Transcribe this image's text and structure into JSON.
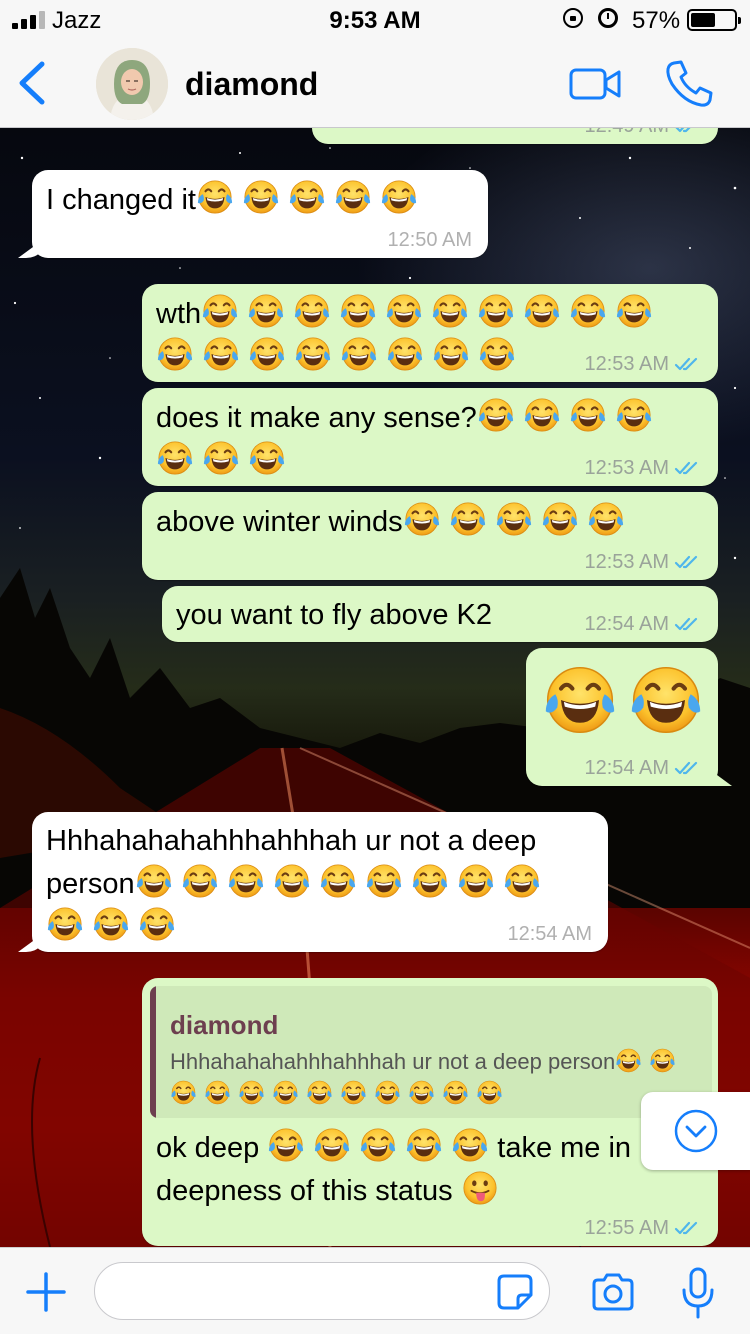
{
  "status_bar": {
    "carrier": "Jazz",
    "time": "9:53 AM",
    "battery_percent": "57%",
    "battery_level": 0.57,
    "signal_bars_active": 3,
    "signal_bars_total": 4
  },
  "header": {
    "back_icon": "chevron-left-icon",
    "contact_name": "diamond",
    "video_call_icon": "video-camera-icon",
    "voice_call_icon": "phone-icon",
    "accent_color": "#157efb"
  },
  "messages": [
    {
      "id": "m0",
      "direction": "outgoing",
      "text": "",
      "time": "12:49 AM",
      "status": "read",
      "partially_visible": true
    },
    {
      "id": "m1",
      "direction": "incoming",
      "text": "I changed it",
      "emoji_count": 5,
      "time": "12:50 AM"
    },
    {
      "id": "m2",
      "direction": "outgoing",
      "text": "wth",
      "emoji_count": 18,
      "time": "12:53 AM",
      "status": "read"
    },
    {
      "id": "m3",
      "direction": "outgoing",
      "text": "does it make any sense?",
      "emoji_count": 7,
      "time": "12:53 AM",
      "status": "read"
    },
    {
      "id": "m4",
      "direction": "outgoing",
      "text": "above winter winds",
      "emoji_count": 5,
      "time": "12:53 AM",
      "status": "read"
    },
    {
      "id": "m5",
      "direction": "outgoing",
      "text": "you want to fly above K2",
      "time": "12:54 AM",
      "status": "read"
    },
    {
      "id": "m6",
      "direction": "outgoing",
      "text": "",
      "emoji_count": 2,
      "time": "12:54 AM",
      "status": "read",
      "jumbo_emoji": true
    },
    {
      "id": "m7",
      "direction": "incoming",
      "text": "Hhhahahahahhhahhhah ur not a deep person",
      "emoji_count": 12,
      "time": "12:54 AM"
    },
    {
      "id": "m8",
      "direction": "outgoing",
      "reply_to": {
        "name": "diamond",
        "text": "Hhhahahahahhhahhhah ur not a deep person",
        "emoji_count": 12
      },
      "text_part1": "ok deep",
      "emoji_count": 5,
      "text_part2": "take me in deepness of this status",
      "trailing_emoji": "tongue-out-emoji",
      "time": "12:55 AM",
      "status": "read"
    }
  ],
  "emoji": {
    "name": "tears-of-joy-emoji"
  },
  "composer": {
    "placeholder": "",
    "value": "",
    "icons": [
      "plus-icon",
      "sticker-icon",
      "camera-icon",
      "microphone-icon"
    ]
  },
  "scroll_down_icon": "chevron-down-circle-icon",
  "colors": {
    "outgoing_bubble": "#dcf8c6",
    "incoming_bubble": "#ffffff",
    "read_ticks": "#4fb6ec",
    "quote_author": "#6d3f4f"
  }
}
